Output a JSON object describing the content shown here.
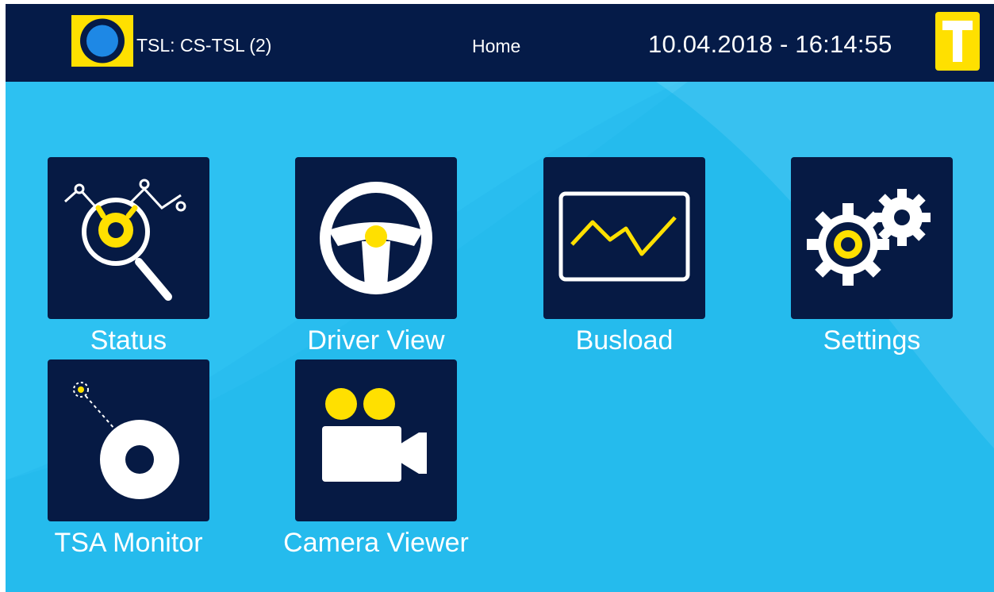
{
  "header": {
    "connection_label": "TSL: CS-TSL (2)",
    "screen_title": "Home",
    "datetime": "10.04.2018 - 16:14:55",
    "connection_icon": "connection-status-icon",
    "logo_letter": "T"
  },
  "tiles": [
    {
      "label": "Status",
      "icon": "status-magnifier-icon"
    },
    {
      "label": "Driver View",
      "icon": "steering-wheel-icon"
    },
    {
      "label": "Busload",
      "icon": "busload-chart-icon"
    },
    {
      "label": "Settings",
      "icon": "gears-icon"
    },
    {
      "label": "TSA Monitor",
      "icon": "tsa-monitor-icon"
    },
    {
      "label": "Camera Viewer",
      "icon": "video-camera-icon"
    }
  ],
  "colors": {
    "background": "#29bdef",
    "header": "#051b48",
    "tile": "#061a44",
    "accent_yellow": "#ffe000",
    "icon_white": "#ffffff"
  }
}
